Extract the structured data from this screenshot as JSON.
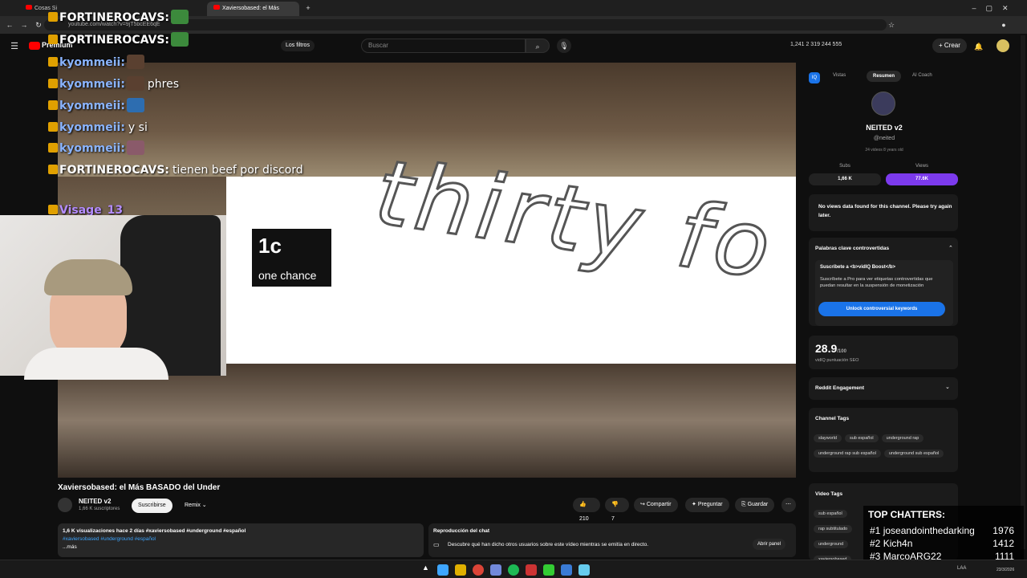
{
  "browser": {
    "tabs": [
      {
        "label": "Cosas Si"
      },
      {
        "label": "Xaviersobased: el Más BASAD"
      }
    ],
    "url": "youtube.com/watch?v=9jT5bcEE6qE"
  },
  "youtube": {
    "logo": "Premium",
    "filters_label": "Los filtros",
    "search_placeholder": "Buscar",
    "header_stats": "1,241  2  319  244  555",
    "create_label": "Crear"
  },
  "video": {
    "title": "Xaviersobased: el Más BASADO del Under",
    "overlay_big": "1c",
    "overlay_small": "one chance",
    "overlay_text": "thirty fo",
    "channel_name": "NEITED v2",
    "channel_subs": "1,66 K suscriptores",
    "subscribe_label": "Suscribirse",
    "remix_label": "Remix",
    "likes": "210",
    "dislikes": "7",
    "share_label": "Compartir",
    "ask_label": "Preguntar",
    "save_label": "Guardar",
    "views_line": "1,6 K visualizaciones  hace 2 días  #xaviersobased #underground #español",
    "hashtags": "#xaviersobased #underground #español",
    "more": "...más",
    "chat_replay_title": "Reproducción del chat",
    "chat_replay_desc": "Descubre qué han dicho otros usuarios sobre este vídeo mientras se emitía en directo.",
    "open_panel": "Abrir panel"
  },
  "chat": [
    {
      "name": "FORTINEROCAVS:",
      "text": "",
      "color": "#ffffff"
    },
    {
      "name": "FORTINEROCAVS:",
      "text": "",
      "color": "#ffffff"
    },
    {
      "name": "kyommeii:",
      "text": "",
      "color": "#8ab4ff"
    },
    {
      "name": "kyommeii:",
      "text": "phres",
      "color": "#8ab4ff"
    },
    {
      "name": "kyommeii:",
      "text": "",
      "color": "#8ab4ff"
    },
    {
      "name": "kyommeii:",
      "text": "y si",
      "color": "#8ab4ff"
    },
    {
      "name": "kyommeii:",
      "text": "",
      "color": "#8ab4ff"
    },
    {
      "name": "FORTINEROCAVS:",
      "text": "tienen beef por discord",
      "color": "#ffffff"
    },
    {
      "name": "Visage_13",
      "text": "",
      "color": "#b48cff"
    }
  ],
  "vidiq": {
    "tabs": [
      "Vistas",
      "Resumen",
      "AI Coach"
    ],
    "channel": "NEITED v2",
    "handle": "@neited",
    "meta": "24 videos    8 years old",
    "subs_label": "Subs",
    "subs_value": "1,66 K",
    "views_label": "Views",
    "views_value": "77.6K",
    "no_views": "No views data found for this channel. Please try again later.",
    "controversial_title": "Palabras clave controvertidas",
    "boost_title": "Suscríbete a <b>vidIQ Boost</b>",
    "boost_desc": "Suscríbete a Pro para ver etiquetas controvertidas que puedan resultar en la suspensión de monetización",
    "unlock_label": "Unlock controversial keywords",
    "seo_score": "28.9",
    "seo_max": "/100",
    "seo_label": "vidIQ puntuación SEO",
    "reddit_label": "Reddit Engagement",
    "channel_tags_label": "Channel Tags",
    "channel_tags": [
      "slayworld",
      "sub español",
      "underground rap",
      "underground rap sub español",
      "underground sub español"
    ],
    "video_tags_label": "Video Tags",
    "video_tags": [
      "sub español",
      "rap subtitulado",
      "underground",
      "xaviersobased"
    ]
  },
  "top_chatters": {
    "title": "TOP CHATTERS:",
    "rows": [
      {
        "rank": "#1",
        "name": "joseandointhedarking",
        "value": "1976"
      },
      {
        "rank": "#2",
        "name": "Kich4n",
        "value": "1412"
      },
      {
        "rank": "#3",
        "name": "MarcoARG22",
        "value": "1111"
      }
    ]
  },
  "taskbar": {
    "lang": "LAA",
    "date": "23/3/2026"
  },
  "colors": {
    "accent_blue": "#1a73e8",
    "vidiq_purple": "#7c3aed",
    "youtube_red": "#ff0000"
  }
}
